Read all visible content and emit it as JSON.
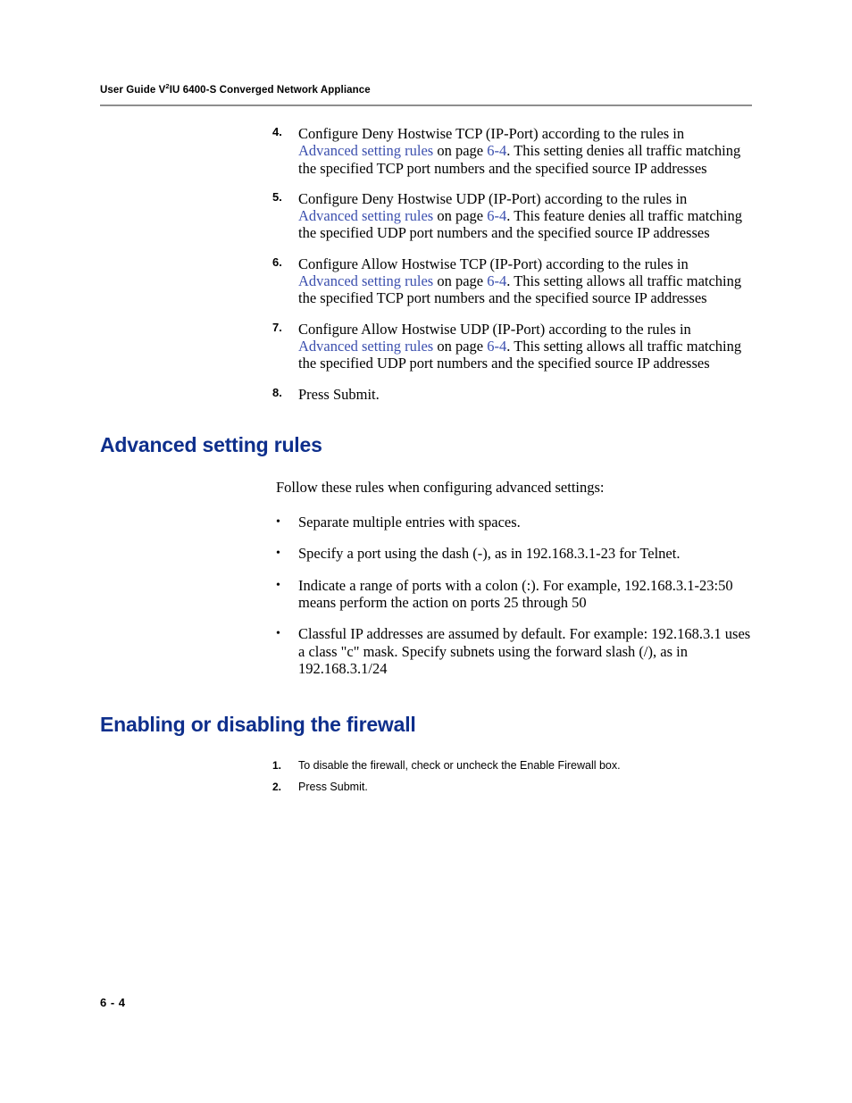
{
  "header": {
    "title_pre": "User Guide V",
    "title_sup": "2",
    "title_post": "IU 6400-S Converged Network Appliance"
  },
  "steps": [
    {
      "num": "4.",
      "pre": "Configure Deny Hostwise TCP (IP-Port) according to the rules in ",
      "link": "Advanced setting rules",
      "mid": " on page ",
      "pagelink": "6-4",
      "post": ". This setting denies all traffic matching the specified TCP port numbers and the specified source IP addresses"
    },
    {
      "num": "5.",
      "pre": "Configure Deny Hostwise UDP (IP-Port) according to the rules in ",
      "link": "Advanced setting rules",
      "mid": " on page ",
      "pagelink": "6-4",
      "post": ". This feature denies all traffic matching the specified UDP port numbers and the specified source IP addresses"
    },
    {
      "num": "6.",
      "pre": "Configure Allow Hostwise TCP (IP-Port) according to the rules in ",
      "link": "Advanced setting rules",
      "mid": " on page ",
      "pagelink": "6-4",
      "post": ". This setting allows all traffic matching the specified TCP port numbers and the specified source IP addresses"
    },
    {
      "num": "7.",
      "pre": "Configure Allow Hostwise UDP (IP-Port) according to the rules in ",
      "link": "Advanced setting rules",
      "mid": " on page ",
      "pagelink": "6-4",
      "post": ". This setting allows all traffic matching the specified UDP port numbers and the specified source IP addresses"
    }
  ],
  "step8": {
    "num": "8.",
    "text": "Press Submit."
  },
  "section1": {
    "heading": "Advanced setting rules",
    "intro": "Follow these rules when configuring advanced settings:",
    "bullets": [
      "Separate multiple entries with spaces.",
      "Specify a port using the dash (-), as in 192.168.3.1-23 for Telnet.",
      "Indicate a range of ports with a colon (:). For example, 192.168.3.1-23:50 means perform the action on ports 25 through 50",
      "Classful IP addresses are assumed by default. For example: 192.168.3.1 uses a class \"c\" mask. Specify subnets using the forward slash (/), as in 192.168.3.1/24"
    ]
  },
  "section2": {
    "heading": "Enabling or disabling the firewall",
    "steps": [
      {
        "num": "1.",
        "text": "To disable the firewall, check or uncheck the Enable Firewall box."
      },
      {
        "num": "2.",
        "text": "Press Submit."
      }
    ]
  },
  "footer": {
    "page_number": "6 - 4"
  }
}
